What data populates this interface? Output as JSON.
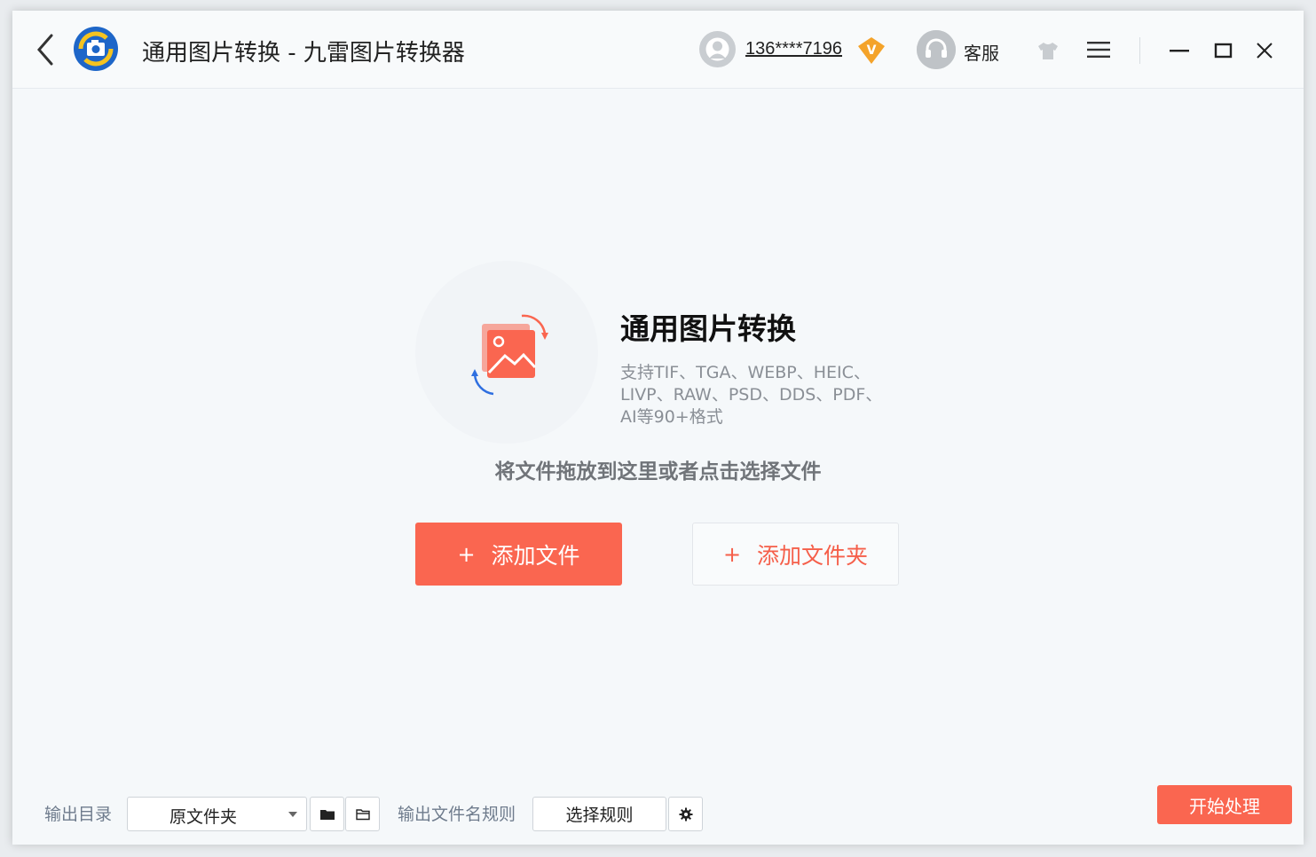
{
  "header": {
    "title": "通用图片转换 - 九雷图片转换器",
    "account": "136****7196",
    "vip_badge": "V",
    "support_label": "客服"
  },
  "hero": {
    "title": "通用图片转换",
    "formats": "支持TIF、TGA、WEBP、HEIC、LIVP、RAW、PSD、DDS、PDF、AI等90+格式",
    "drop_hint": "将文件拖放到这里或者点击选择文件"
  },
  "actions": {
    "plus": "+",
    "add_file": "添加文件",
    "add_folder": "添加文件夹"
  },
  "footer": {
    "output_dir_label": "输出目录",
    "output_dir_value": "原文件夹",
    "filename_rule_label": "输出文件名规则",
    "select_rule": "选择规则",
    "start": "开始处理"
  },
  "colors": {
    "accent": "#fa6650",
    "logo_blue": "#1e66c8",
    "logo_yellow": "#f5c320",
    "vip_orange": "#f4a32a"
  },
  "icons": [
    "back-icon",
    "app-logo-icon",
    "user-avatar-icon",
    "vip-icon",
    "headset-icon",
    "tshirt-icon",
    "menu-icon",
    "minimize-icon",
    "maximize-icon",
    "close-icon",
    "image-convert-icon",
    "folder-icon",
    "open-folder-icon",
    "gear-icon"
  ]
}
